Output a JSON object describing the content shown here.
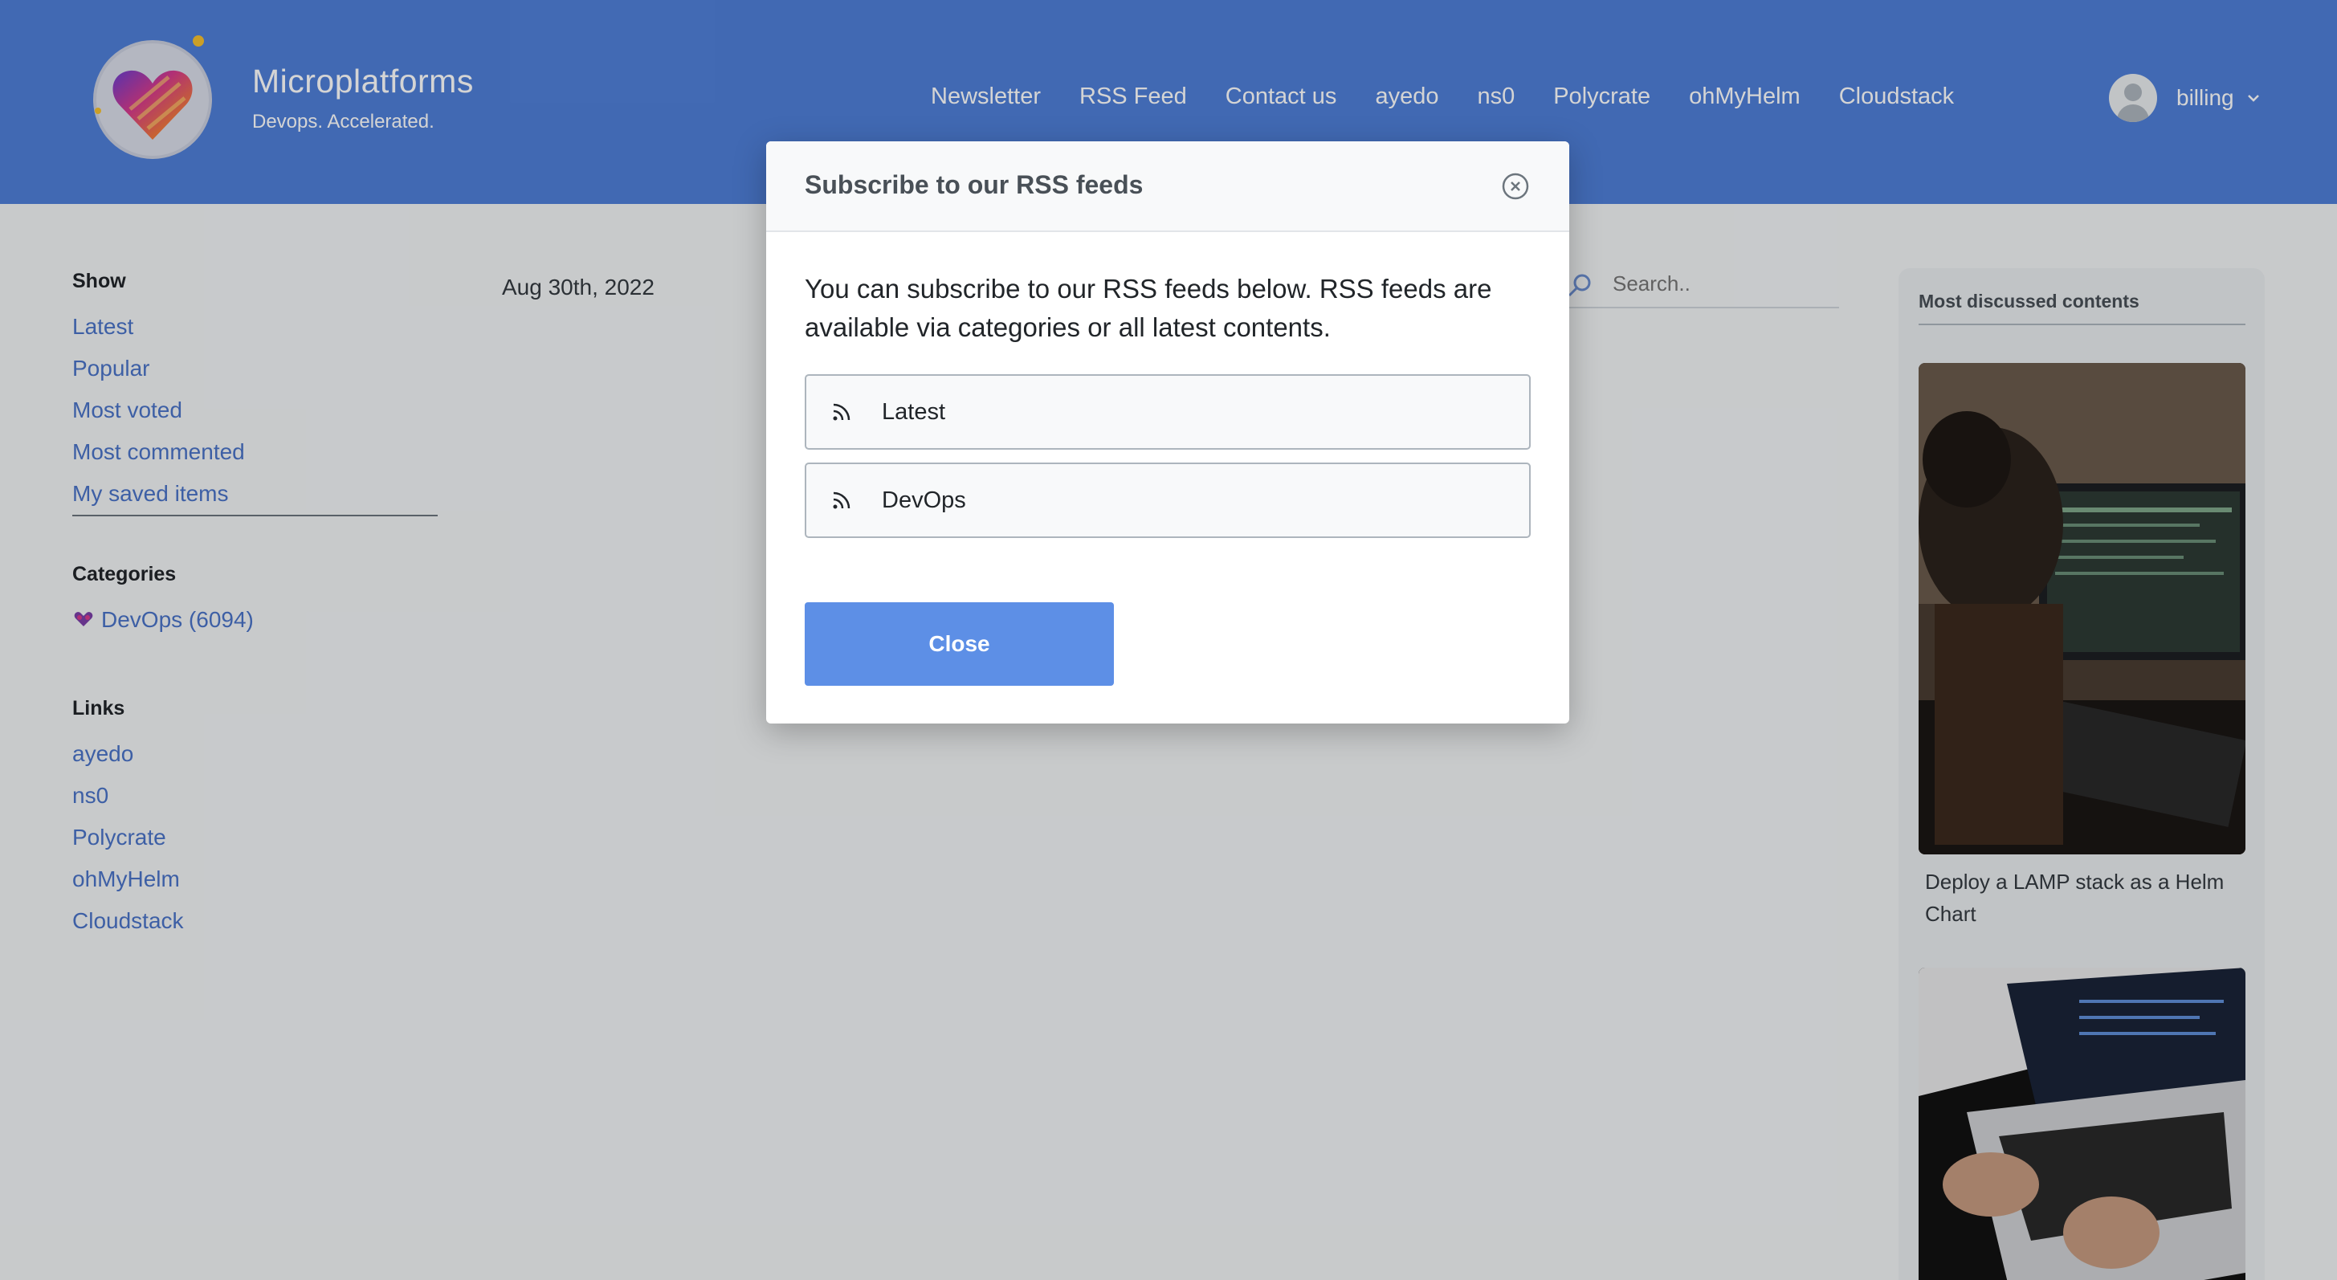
{
  "brand": {
    "title": "Microplatforms",
    "subtitle": "Devops. Accelerated."
  },
  "topnav": [
    "Newsletter",
    "RSS Feed",
    "Contact us",
    "ayedo",
    "ns0",
    "Polycrate",
    "ohMyHelm",
    "Cloudstack"
  ],
  "user": {
    "name": "billing"
  },
  "sidebar": {
    "show_title": "Show",
    "show_items": [
      "Latest",
      "Popular",
      "Most voted",
      "Most commented",
      "My saved items"
    ],
    "categories_title": "Categories",
    "categories": [
      "DevOps (6094)"
    ],
    "links_title": "Links",
    "links": [
      "ayedo",
      "ns0",
      "Polycrate",
      "ohMyHelm",
      "Cloudstack"
    ]
  },
  "main": {
    "date": "Aug 30th, 2022"
  },
  "search": {
    "placeholder": "Search.."
  },
  "right_panel": {
    "title": "Most discussed contents",
    "items": [
      {
        "caption": "Deploy a LAMP stack as a Helm Chart"
      }
    ]
  },
  "modal": {
    "title": "Subscribe to our RSS feeds",
    "text": "You can subscribe to our RSS feeds below. RSS feeds are available via categories or all latest contents.",
    "feeds": [
      "Latest",
      "DevOps"
    ],
    "close_label": "Close"
  },
  "colors": {
    "header": "#4f7fd8",
    "link": "#4a73c7",
    "button": "#5d8fe6"
  }
}
